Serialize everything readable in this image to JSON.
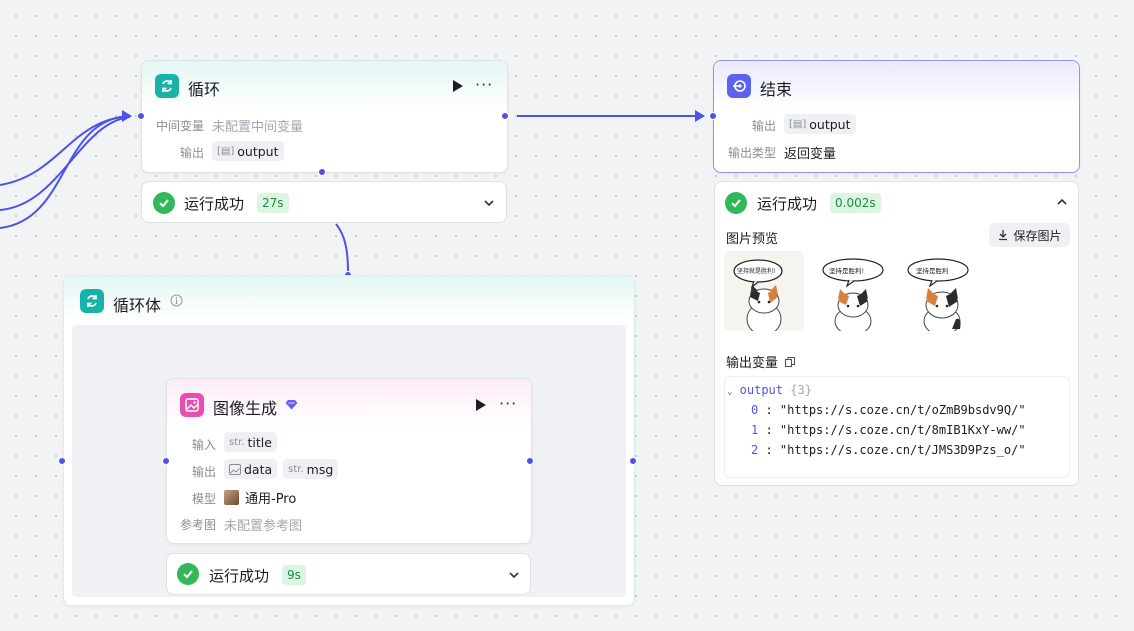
{
  "loop_node": {
    "title": "循环",
    "intermediate_label": "中间变量",
    "intermediate_value": "未配置中间变量",
    "output_label": "输出",
    "output_var": "output",
    "run_status": "运行成功",
    "run_time": "27s"
  },
  "end_node": {
    "title": "结束",
    "output_label": "输出",
    "output_var": "output",
    "output_type_label": "输出类型",
    "output_type_value": "返回变量",
    "run_status": "运行成功",
    "run_time": "0.002s",
    "preview_label": "图片预览",
    "save_button": "保存图片",
    "images": [
      {
        "caption": "坚持就是胜利!"
      },
      {
        "caption": "坚持是胜利!"
      },
      {
        "caption": "坚持是胜利"
      }
    ],
    "output_vars_label": "输出变量",
    "json": {
      "key": "output",
      "count": "{3}",
      "items": [
        {
          "index": "0",
          "value": "\"https://s.coze.cn/t/oZmB9bsdv9Q/\""
        },
        {
          "index": "1",
          "value": "\"https://s.coze.cn/t/8mIB1KxY-ww/\""
        },
        {
          "index": "2",
          "value": "\"https://s.coze.cn/t/JMS3D9Pzs_o/\""
        }
      ]
    }
  },
  "loop_body": {
    "title": "循环体"
  },
  "image_node": {
    "title": "图像生成",
    "input_label": "输入",
    "input_type": "str.",
    "input_var": "title",
    "output_label": "输出",
    "output_var1": "data",
    "output_type2": "str.",
    "output_var2": "msg",
    "model_label": "模型",
    "model_value": "通用-Pro",
    "ref_label": "参考图",
    "ref_value": "未配置参考图",
    "run_status": "运行成功",
    "run_time": "9s"
  },
  "colors": {
    "accent": "#4d53e8",
    "loop_icon": "#17b2a8",
    "end_icon": "#5b62ef",
    "image_icon": "#e64fae",
    "success": "#30b85a"
  }
}
